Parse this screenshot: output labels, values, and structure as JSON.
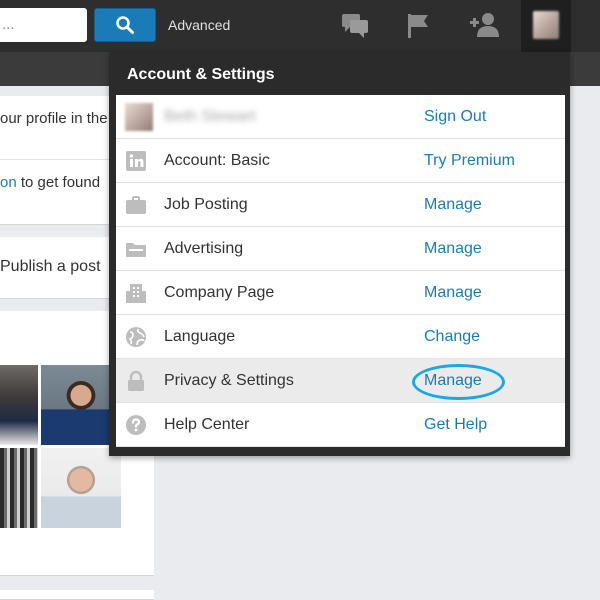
{
  "topbar": {
    "search_placeholder": "...",
    "advanced_label": "Advanced",
    "icons": [
      "search-icon",
      "messages-icon",
      "notifications-flag-icon",
      "add-connection-icon"
    ],
    "accent": "#1b7bb7"
  },
  "background": {
    "card1_line1": "our profile in the",
    "card1_link": "on",
    "card1_line2_rest": " to get found",
    "card2_text": "Publish a post"
  },
  "dropdown": {
    "title": "Account & Settings",
    "user": {
      "name": "Beth Stewart",
      "action": "Sign Out"
    },
    "items": [
      {
        "icon": "linkedin-icon",
        "label": "Account: Basic",
        "action": "Try Premium"
      },
      {
        "icon": "briefcase-icon",
        "label": "Job Posting",
        "action": "Manage"
      },
      {
        "icon": "folder-icon",
        "label": "Advertising",
        "action": "Manage"
      },
      {
        "icon": "building-icon",
        "label": "Company Page",
        "action": "Manage"
      },
      {
        "icon": "globe-icon",
        "label": "Language",
        "action": "Change"
      },
      {
        "icon": "lock-icon",
        "label": "Privacy & Settings",
        "action": "Manage",
        "highlighted": true
      },
      {
        "icon": "help-icon",
        "label": "Help Center",
        "action": "Get Help"
      }
    ],
    "highlight_ring_color": "#17a9e6"
  }
}
